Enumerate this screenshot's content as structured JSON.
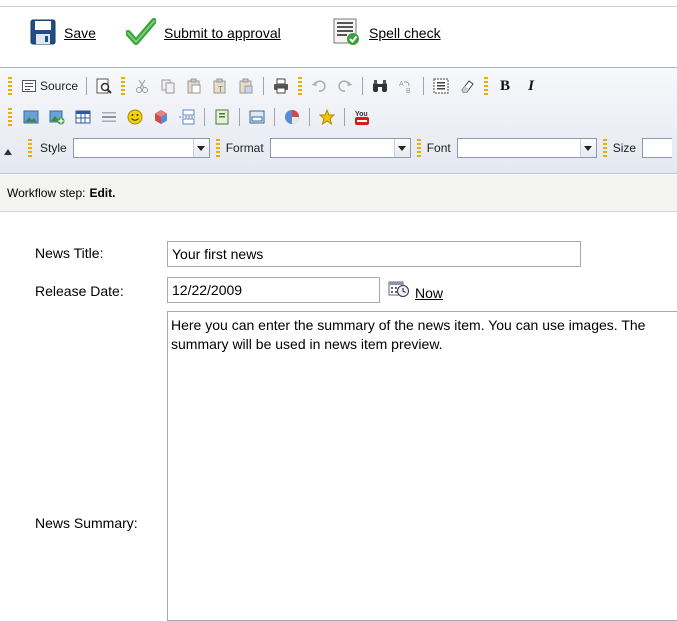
{
  "actions": {
    "save_label": "Save",
    "submit_label": "Submit to approval",
    "spell_label": "Spell check"
  },
  "editor": {
    "source_label": "Source",
    "bold_glyph": "B",
    "italic_glyph": "I",
    "youtube_label": "You",
    "combos": {
      "style_label": "Style",
      "style_value": "",
      "format_label": "Format",
      "format_value": "",
      "font_label": "Font",
      "font_value": "",
      "size_label": "Size",
      "size_value": ""
    }
  },
  "workflow": {
    "label": "Workflow step:",
    "step": "Edit."
  },
  "form": {
    "title_label": "News Title:",
    "title_value": "Your first news",
    "date_label": "Release Date:",
    "date_value": "12/22/2009",
    "now_label": "Now",
    "summary_label": "News Summary:",
    "summary_value": "Here you can enter the summary of the news item. You can use images. The summary will be used in news item preview."
  },
  "colors": {
    "toolbar_bg": "#e4e8f0",
    "workflow_bg": "#f3f3ef",
    "check_green": "#3aa13a",
    "grip_yellow": "#e3b100"
  }
}
